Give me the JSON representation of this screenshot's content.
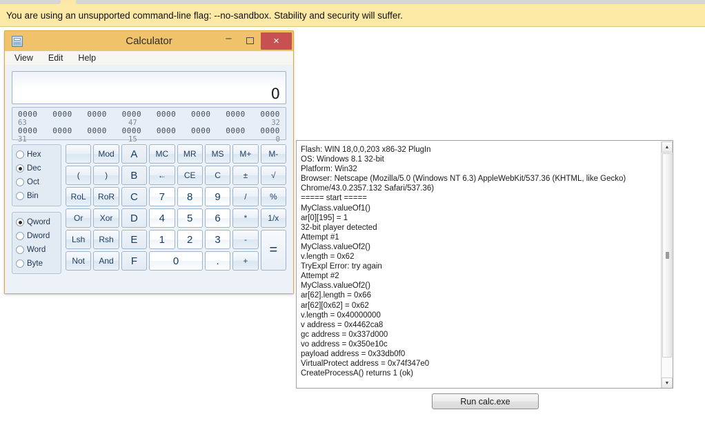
{
  "browser": {
    "infobar_message": "You are using an unsupported command-line flag: --no-sandbox. Stability and security will suffer.",
    "infobar_bg": "#fbe9a5"
  },
  "calculator": {
    "title": "Calculator",
    "icon": "calculator-icon",
    "window_controls": {
      "minimize": "–",
      "maximize": "",
      "close": "×",
      "close_bg": "#c75050"
    },
    "titlebar_bg": "#f0c36a",
    "menu": [
      "View",
      "Edit",
      "Help"
    ],
    "display_value": "0",
    "bit_display": {
      "row1_groups": [
        "0000",
        "0000",
        "0000",
        "0000",
        "0000",
        "0000",
        "0000",
        "0000"
      ],
      "row1_labels": {
        "left": "63",
        "mid": "47",
        "right": "32"
      },
      "row2_groups": [
        "0000",
        "0000",
        "0000",
        "0000",
        "0000",
        "0000",
        "0000",
        "0000"
      ],
      "row2_labels": {
        "left": "31",
        "mid": "15",
        "right": "0"
      }
    },
    "base_modes": [
      {
        "label": "Hex",
        "checked": false
      },
      {
        "label": "Dec",
        "checked": true
      },
      {
        "label": "Oct",
        "checked": false
      },
      {
        "label": "Bin",
        "checked": false
      }
    ],
    "word_sizes": [
      {
        "label": "Qword",
        "checked": true
      },
      {
        "label": "Dword",
        "checked": false
      },
      {
        "label": "Word",
        "checked": false
      },
      {
        "label": "Byte",
        "checked": false
      }
    ],
    "keys": [
      {
        "label": "",
        "kind": "blank"
      },
      {
        "label": "Mod",
        "kind": "op"
      },
      {
        "label": "A",
        "kind": "hex"
      },
      {
        "label": "MC",
        "kind": "op"
      },
      {
        "label": "MR",
        "kind": "op"
      },
      {
        "label": "MS",
        "kind": "op"
      },
      {
        "label": "M+",
        "kind": "op"
      },
      {
        "label": "M-",
        "kind": "op"
      },
      {
        "label": "(",
        "kind": "op"
      },
      {
        "label": ")",
        "kind": "op"
      },
      {
        "label": "B",
        "kind": "hex"
      },
      {
        "label": "←",
        "kind": "op"
      },
      {
        "label": "CE",
        "kind": "op"
      },
      {
        "label": "C",
        "kind": "op"
      },
      {
        "label": "±",
        "kind": "op"
      },
      {
        "label": "√",
        "kind": "op"
      },
      {
        "label": "RoL",
        "kind": "op"
      },
      {
        "label": "RoR",
        "kind": "op"
      },
      {
        "label": "C",
        "kind": "hex"
      },
      {
        "label": "7",
        "kind": "num"
      },
      {
        "label": "8",
        "kind": "num"
      },
      {
        "label": "9",
        "kind": "num"
      },
      {
        "label": "/",
        "kind": "op"
      },
      {
        "label": "%",
        "kind": "op"
      },
      {
        "label": "Or",
        "kind": "op"
      },
      {
        "label": "Xor",
        "kind": "op"
      },
      {
        "label": "D",
        "kind": "hex"
      },
      {
        "label": "4",
        "kind": "num"
      },
      {
        "label": "5",
        "kind": "num"
      },
      {
        "label": "6",
        "kind": "num"
      },
      {
        "label": "*",
        "kind": "op"
      },
      {
        "label": "1/x",
        "kind": "op"
      },
      {
        "label": "Lsh",
        "kind": "op"
      },
      {
        "label": "Rsh",
        "kind": "op"
      },
      {
        "label": "E",
        "kind": "hex"
      },
      {
        "label": "1",
        "kind": "num"
      },
      {
        "label": "2",
        "kind": "num"
      },
      {
        "label": "3",
        "kind": "num"
      },
      {
        "label": "-",
        "kind": "op"
      },
      {
        "label": "=",
        "kind": "equals"
      },
      {
        "label": "Not",
        "kind": "op"
      },
      {
        "label": "And",
        "kind": "op"
      },
      {
        "label": "F",
        "kind": "hex"
      },
      {
        "label": "0",
        "kind": "num-wide"
      },
      {
        "label": ".",
        "kind": "num"
      },
      {
        "label": "+",
        "kind": "op"
      }
    ]
  },
  "log": {
    "lines": [
      "Flash: WIN 18,0,0,203 x86-32 PlugIn",
      "OS: Windows 8.1 32-bit",
      "Platform: Win32",
      "Browser: Netscape (Mozilla/5.0 (Windows NT 6.3) AppleWebKit/537.36 (KHTML, like Gecko)",
      "Chrome/43.0.2357.132 Safari/537.36)",
      "===== start =====",
      "MyClass.valueOf1()",
      "ar[0][195] = 1",
      "32-bit player detected",
      "Attempt #1",
      "MyClass.valueOf2()",
      "v.length = 0x62",
      "TryExpl Error: try again",
      "Attempt #2",
      "MyClass.valueOf2()",
      "ar[62].length = 0x66",
      "ar[62][0x62] = 0x62",
      "v.length = 0x40000000",
      "v address = 0x4462ca8",
      "gc address = 0x337d000",
      "vo address = 0x350e10c",
      "payload address = 0x33db0f0",
      "VirtualProtect address = 0x74f347e0",
      "CreateProcessA() returns 1 (ok)"
    ],
    "scrollbar": {
      "up_arrow": "▲",
      "down_arrow": "▼"
    }
  },
  "run_button": {
    "label": "Run calc.exe"
  }
}
